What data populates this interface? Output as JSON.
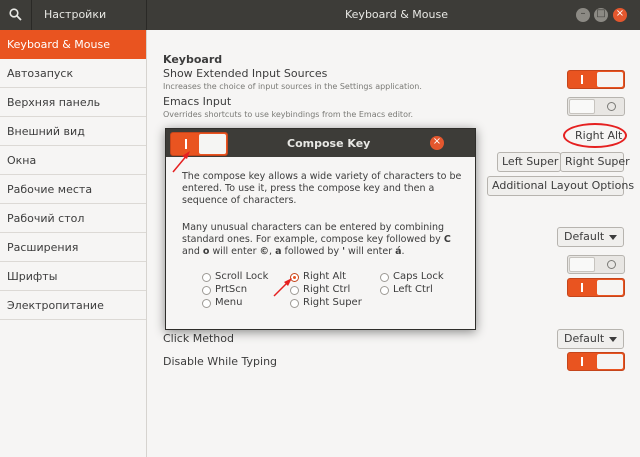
{
  "titlebar": {
    "left_title": "Настройки",
    "center_title": "Keyboard & Mouse"
  },
  "sidebar": {
    "items": [
      {
        "label": "Keyboard & Mouse",
        "active": true
      },
      {
        "label": "Автозапуск"
      },
      {
        "label": "Верхняя панель"
      },
      {
        "label": "Внешний вид"
      },
      {
        "label": "Окна"
      },
      {
        "label": "Рабочие места"
      },
      {
        "label": "Рабочий стол"
      },
      {
        "label": "Расширения"
      },
      {
        "label": "Шрифты"
      },
      {
        "label": "Электропитание"
      }
    ]
  },
  "main": {
    "keyboard_heading": "Keyboard",
    "show_extended_label": "Show Extended Input Sources",
    "show_extended_desc": "Increases the choice of input sources in the Settings application.",
    "show_extended_on": true,
    "emacs_label": "Emacs Input",
    "emacs_desc": "Overrides shortcuts to use keybindings from the Emacs editor.",
    "emacs_on": false,
    "compose_value": "Right Alt",
    "left_super": "Left Super",
    "right_super": "Right Super",
    "additional_layout": "Additional Layout Options",
    "dropdown1_value": "Default",
    "click_method_label": "Click Method",
    "click_method_value": "Default",
    "disable_typing_label": "Disable While Typing",
    "disable_typing_on": true
  },
  "dialog": {
    "title": "Compose Key",
    "enabled": true,
    "para1": "The compose key allows a wide variety of characters to be entered. To use it, press the compose key and then a sequence of characters.",
    "para2_a": "Many unusual characters can be entered by combining standard ones. For example, compose key followed by ",
    "para2_b": "C",
    "para2_c": " and ",
    "para2_d": "o",
    "para2_e": " will enter ",
    "para2_f": "©",
    "para2_g": ", ",
    "para2_h": "a",
    "para2_i": " followed by ",
    "para2_j": "'",
    "para2_k": " will enter ",
    "para2_l": "á",
    "para2_m": ".",
    "options": {
      "scroll_lock": "Scroll Lock",
      "prtscn": "PrtScn",
      "menu": "Menu",
      "right_alt": "Right Alt",
      "right_ctrl": "Right Ctrl",
      "right_super": "Right Super",
      "caps_lock": "Caps Lock",
      "left_ctrl": "Left Ctrl"
    },
    "selected": "right_alt"
  },
  "colors": {
    "accent": "#e95420",
    "titlebar": "#3d3c38",
    "annotation": "#e52020"
  }
}
